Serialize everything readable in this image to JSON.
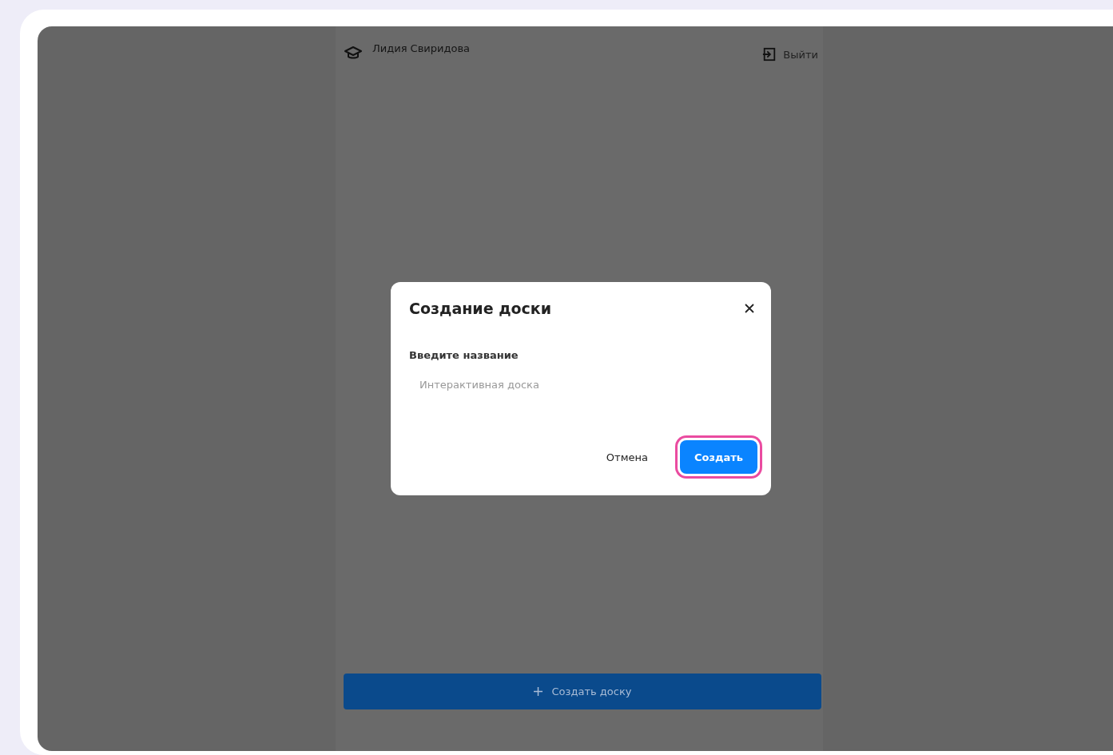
{
  "header": {
    "user_name": "Лидия Свиридова",
    "logout": "Выйти"
  },
  "bottom_button": {
    "label": "Создать доску"
  },
  "dialog": {
    "title": "Создание доски",
    "field": {
      "label": "Введите название",
      "placeholder": "Интерактивная доска"
    },
    "buttons": [
      {
        "label": "Отмена",
        "kind": "text",
        "highlighted": false
      },
      {
        "label": "Создать",
        "kind": "primary",
        "highlighted": true
      }
    ]
  }
}
